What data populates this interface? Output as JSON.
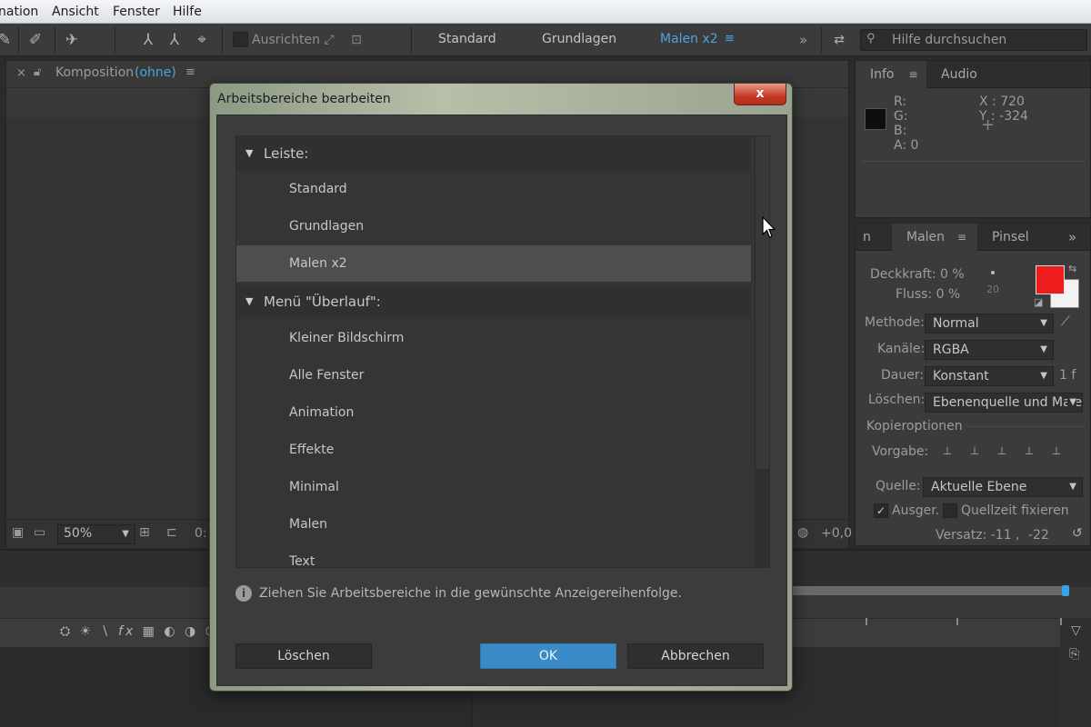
{
  "menubar": {
    "items": [
      "nation",
      "Ansicht",
      "Fenster",
      "Hilfe"
    ]
  },
  "toolbar": {
    "align_label": "Ausrichten",
    "workspaces": [
      {
        "label": "Standard",
        "active": false
      },
      {
        "label": "Grundlagen",
        "active": false
      },
      {
        "label": "Malen x2",
        "active": true
      }
    ],
    "search_placeholder": "Hilfe durchsuchen"
  },
  "comp_panel": {
    "title": "Komposition",
    "title_paren": "(ohne)",
    "zoom": "50%",
    "time_partial": "0:",
    "exposure": "+0,0"
  },
  "info_panel": {
    "tabs": [
      "Info",
      "Audio"
    ],
    "channels": [
      "R:",
      "G:",
      "B:",
      "A:  0"
    ],
    "x": "X : 720",
    "y": "Y : -324"
  },
  "paint_panel": {
    "tabs": [
      "n",
      "Malen",
      "Pinsel"
    ],
    "opacity": "Deckkraft: 0 %",
    "flow": "Fluss: 0 %",
    "brush_size": "20",
    "mode_label": "Methode:",
    "mode_value": "Normal",
    "channels_label": "Kanäle:",
    "channels_value": "RGBA",
    "duration_label": "Dauer:",
    "duration_value": "Konstant",
    "duration_frames": "1 f",
    "erase_label": "Löschen:",
    "erase_value": "Ebenenquelle und Male",
    "clone_section": "Kopieroptionen",
    "preset_label": "Vorgabe:",
    "source_label": "Quelle:",
    "source_value": "Aktuelle Ebene",
    "aligned_label": "Ausger.",
    "lock_time_label": "Quellzeit fixieren",
    "offset_label": "Versatz: -11 ,",
    "offset_y": "-22",
    "foreground_color": "#ee1c1c",
    "background_color": "#f2f2f2"
  },
  "dialog": {
    "title": "Arbeitsbereiche bearbeiten",
    "close_label": "x",
    "groups": [
      {
        "label": "Leiste:",
        "items": [
          "Standard",
          "Grundlagen",
          "Malen x2"
        ],
        "selected": "Malen x2"
      },
      {
        "label": "Menü \"Überlauf\":",
        "items": [
          "Kleiner Bildschirm",
          "Alle Fenster",
          "Animation",
          "Effekte",
          "Minimal",
          "Malen",
          "Text"
        ]
      }
    ],
    "hint": "Ziehen Sie Arbeitsbereiche in die gewünschte Anzeigereihenfolge.",
    "buttons": {
      "delete": "Löschen",
      "ok": "OK",
      "cancel": "Abbrechen"
    },
    "accent_color": "#3b8bc6"
  }
}
